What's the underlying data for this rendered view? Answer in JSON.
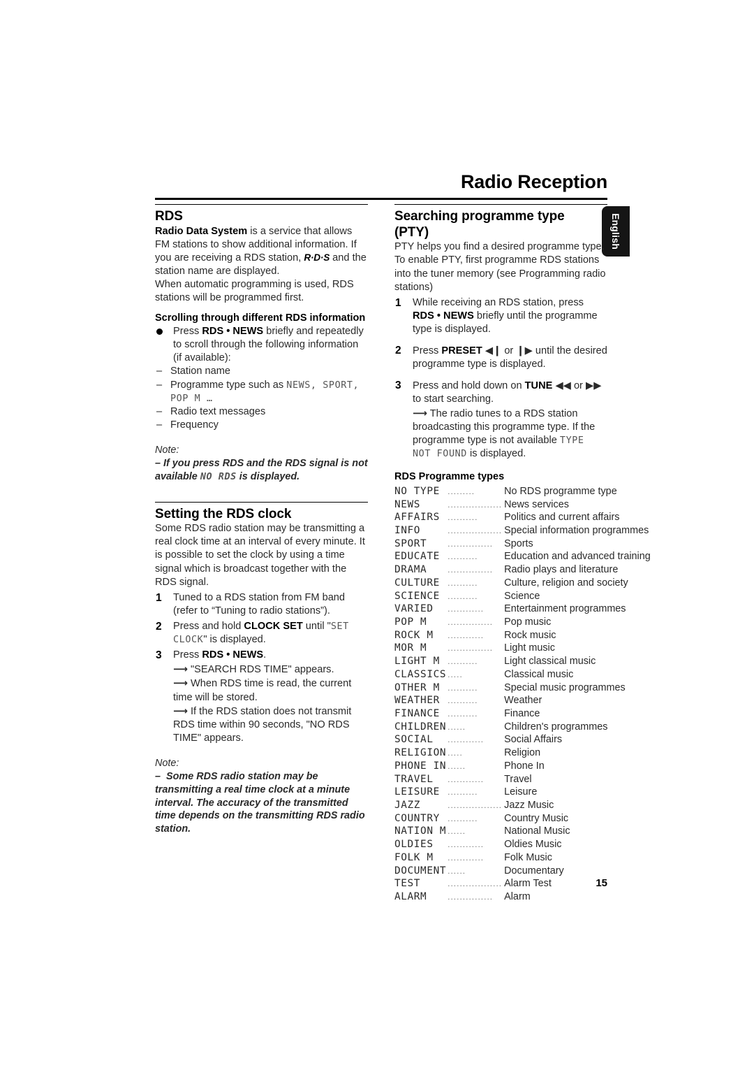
{
  "page": {
    "title": "Radio Reception",
    "language_tab": "English",
    "page_number": "15"
  },
  "left_column": {
    "rds": {
      "heading": "RDS",
      "intro_bold": "Radio Data System",
      "intro_part1": " is a service that allows FM stations to show additional information. If you are receiving a RDS station, ",
      "logo": "R·D·S",
      "intro_part2": " and the station name are displayed.",
      "intro_part3": "When automatic programming is used, RDS stations will be programmed first.",
      "scroll_heading": "Scrolling through different RDS information",
      "bullet_press": "Press ",
      "bullet_bold": "RDS • NEWS",
      "bullet_rest": " briefly and repeatedly to scroll through the following information (if available):",
      "items": [
        {
          "text": "Station name",
          "lcd": ""
        },
        {
          "text": "Programme type such as ",
          "lcd": "NEWS, SPORT, POP M …"
        },
        {
          "text": "Radio text messages",
          "lcd": ""
        },
        {
          "text": "Frequency",
          "lcd": ""
        }
      ],
      "note_label": "Note:",
      "note_dash": "–",
      "note_text_a": "If you press RDS and the RDS signal is not available ",
      "note_lcd": "NO RDS",
      "note_text_b": " is displayed."
    },
    "clock": {
      "heading": "Setting the RDS clock",
      "intro": "Some RDS radio station may be transmitting a real clock time at an interval of every minute.  It is possible to set the clock by using a time signal which is broadcast together with the RDS signal.",
      "steps": [
        {
          "num": "1",
          "text": "Tuned to a RDS station from FM band (refer to “Tuning to radio stations”)."
        },
        {
          "num": "2",
          "pre": "Press and hold ",
          "bold": "CLOCK SET",
          "mid": " until \"",
          "lcd": "SET CLOCK",
          "post": "\" is displayed."
        },
        {
          "num": "3",
          "pre": "Press ",
          "bold": "RDS • NEWS",
          "post": "."
        }
      ],
      "arrows": [
        "\"SEARCH RDS TIME\" appears.",
        "When RDS time is read, the current time will be stored.",
        "If the RDS station does not transmit RDS time within 90 seconds, \"NO RDS TIME\" appears."
      ],
      "note_label": "Note:",
      "note_dash": "–",
      "note_text": "Some RDS radio station may be transmitting a real time clock at a minute interval. The accuracy of the transmitted time depends on the transmitting RDS radio station."
    }
  },
  "right_column": {
    "pty": {
      "heading_line1": "Searching programme type",
      "heading_line2": "(PTY)",
      "intro": "PTY helps you find a desired programme type. To enable PTY, first programme RDS stations into the tuner memory (see Programming radio stations)",
      "steps": [
        {
          "num": "1",
          "pre": "While receiving an RDS station, press ",
          "bold": "RDS • NEWS",
          "post": " briefly until the programme type is displayed."
        },
        {
          "num": "2",
          "pre": "Press ",
          "bold": "PRESET",
          "glyph_a": "◀❙",
          "mid": " or ",
          "glyph_b": "❙▶",
          "post": " until the desired programme type is displayed."
        },
        {
          "num": "3",
          "pre": "Press and hold down on ",
          "bold": "TUNE",
          "glyph_a": "◀◀",
          "mid": " or ",
          "glyph_b": "▶▶",
          "post": " to start searching."
        }
      ],
      "arrow_pre": "The radio tunes to a RDS station broadcasting this programme type. If the programme type is not available ",
      "arrow_lcd": "TYPE NOT FOUND",
      "arrow_post": " is displayed.",
      "types_heading": "RDS Programme types"
    },
    "programme_types": [
      {
        "code": "NO TYPE",
        "leader": ".........",
        "desc": "No RDS programme type"
      },
      {
        "code": "NEWS",
        "leader": "..................",
        "desc": "News services"
      },
      {
        "code": "AFFAIRS",
        "leader": "..........",
        "desc": "Politics and current affairs"
      },
      {
        "code": "INFO",
        "leader": "..................",
        "desc": "Special information programmes"
      },
      {
        "code": "SPORT",
        "leader": "...............",
        "desc": "Sports"
      },
      {
        "code": "EDUCATE",
        "leader": "..........",
        "desc": "Education and advanced training"
      },
      {
        "code": "DRAMA",
        "leader": "...............",
        "desc": "Radio plays and literature"
      },
      {
        "code": "CULTURE",
        "leader": "..........",
        "desc": "Culture, religion and society"
      },
      {
        "code": "SCIENCE",
        "leader": "..........",
        "desc": "Science"
      },
      {
        "code": "VARIED",
        "leader": "............",
        "desc": "Entertainment programmes"
      },
      {
        "code": "POP M",
        "leader": "...............",
        "desc": "Pop music"
      },
      {
        "code": "ROCK M",
        "leader": "............",
        "desc": "Rock music"
      },
      {
        "code": "MOR M",
        "leader": "...............",
        "desc": "Light music"
      },
      {
        "code": "LIGHT M",
        "leader": "..........",
        "desc": "Light classical music"
      },
      {
        "code": "CLASSICS",
        "leader": ".....",
        "desc": "Classical music"
      },
      {
        "code": "OTHER M",
        "leader": "..........",
        "desc": "Special music programmes"
      },
      {
        "code": "WEATHER",
        "leader": "..........",
        "desc": "Weather"
      },
      {
        "code": "FINANCE",
        "leader": "..........",
        "desc": "Finance"
      },
      {
        "code": "CHILDREN",
        "leader": "......",
        "desc": "Children's programmes"
      },
      {
        "code": "SOCIAL",
        "leader": "............",
        "desc": "Social Affairs"
      },
      {
        "code": "RELIGION",
        "leader": ".....",
        "desc": "Religion"
      },
      {
        "code": "PHONE IN",
        "leader": "......",
        "desc": "Phone In"
      },
      {
        "code": "TRAVEL",
        "leader": "............",
        "desc": "Travel"
      },
      {
        "code": "LEISURE",
        "leader": "..........",
        "desc": "Leisure"
      },
      {
        "code": "JAZZ",
        "leader": "..................",
        "desc": "Jazz Music"
      },
      {
        "code": "COUNTRY",
        "leader": "..........",
        "desc": "Country Music"
      },
      {
        "code": "NATION M",
        "leader": "......",
        "desc": "National Music"
      },
      {
        "code": "OLDIES",
        "leader": "............",
        "desc": "Oldies Music"
      },
      {
        "code": "FOLK M",
        "leader": "............",
        "desc": "Folk Music"
      },
      {
        "code": "DOCUMENT",
        "leader": "......",
        "desc": "Documentary"
      },
      {
        "code": "TEST",
        "leader": "..................",
        "desc": "Alarm Test"
      },
      {
        "code": "ALARM",
        "leader": "...............",
        "desc": "Alarm"
      }
    ]
  }
}
